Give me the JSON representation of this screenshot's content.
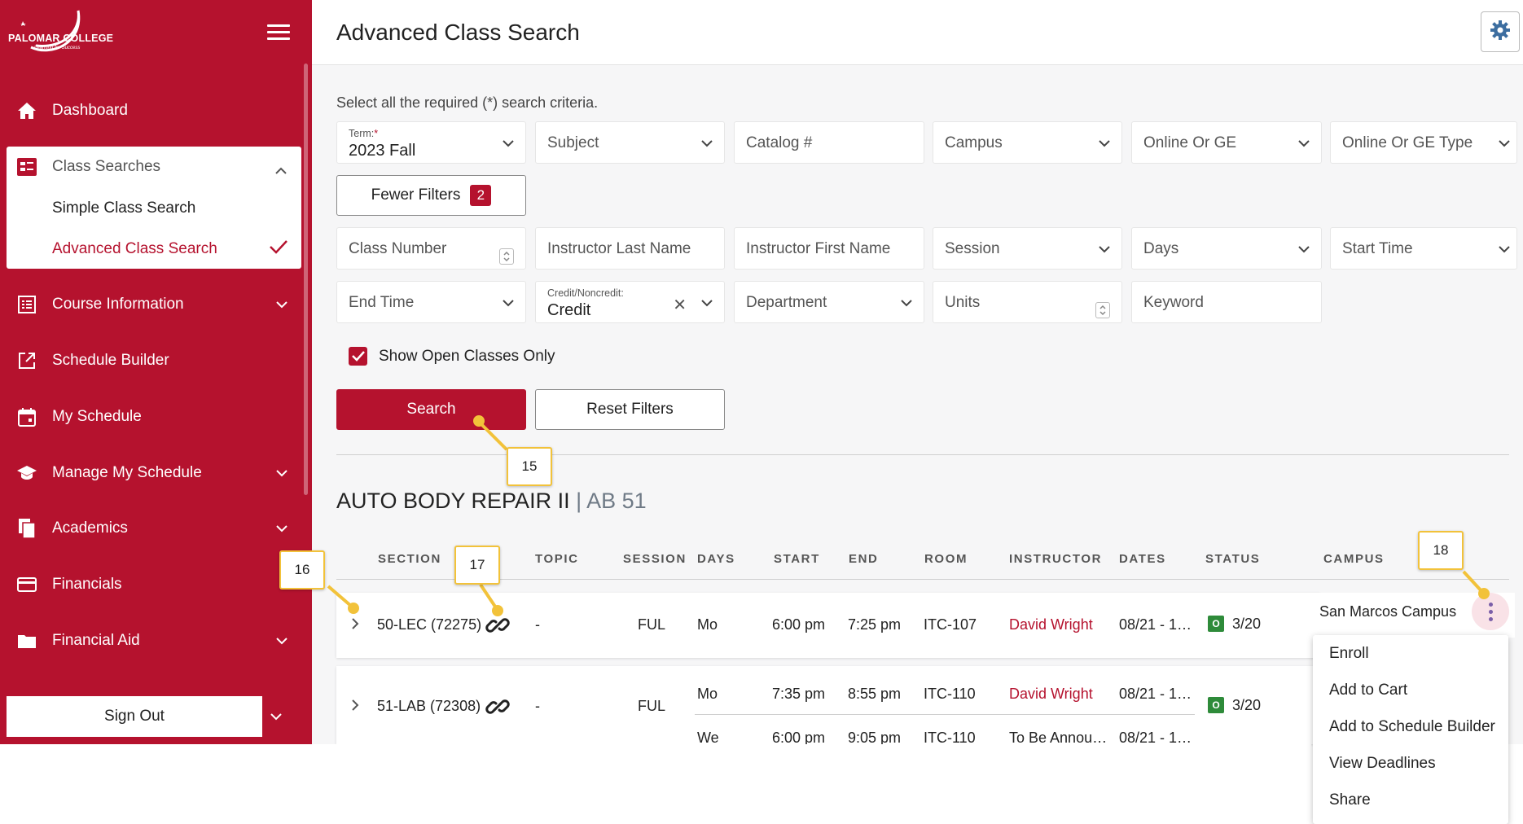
{
  "brand": {
    "name": "PALOMAR COLLEGE",
    "tagline": "Learning for Success"
  },
  "sidebar": {
    "items": [
      {
        "label": "Dashboard",
        "icon": "home-icon"
      },
      {
        "label": "Class Searches",
        "icon": "search-list-icon",
        "open": true,
        "children": [
          {
            "label": "Simple Class Search"
          },
          {
            "label": "Advanced Class Search",
            "active": true
          }
        ]
      },
      {
        "label": "Course Information",
        "icon": "list-icon"
      },
      {
        "label": "Schedule Builder",
        "icon": "external-edit-icon"
      },
      {
        "label": "My Schedule",
        "icon": "calendar-icon"
      },
      {
        "label": "Manage My Schedule",
        "icon": "graduation-cap-icon"
      },
      {
        "label": "Academics",
        "icon": "documents-icon"
      },
      {
        "label": "Financials",
        "icon": "credit-card-icon"
      },
      {
        "label": "Financial Aid",
        "icon": "folder-icon"
      }
    ],
    "sign_out": "Sign Out"
  },
  "header": {
    "title": "Advanced Class Search"
  },
  "search": {
    "instructions": "Select all the required (*) search criteria.",
    "term": {
      "label": "Term:",
      "required_mark": "*",
      "value": "2023 Fall"
    },
    "subject": "Subject",
    "catalog": "Catalog #",
    "campus": "Campus",
    "online_or_ge": "Online Or GE",
    "online_or_ge_type": "Online Or GE Type",
    "fewer_filters": "Fewer Filters",
    "filter_count": "2",
    "class_number": "Class Number",
    "instructor_last": "Instructor Last Name",
    "instructor_first": "Instructor First Name",
    "session": "Session",
    "days": "Days",
    "start_time": "Start Time",
    "end_time": "End Time",
    "credit": {
      "label": "Credit/Noncredit:",
      "value": "Credit",
      "clear": "✕"
    },
    "department": "Department",
    "units": "Units",
    "keyword": "Keyword",
    "open_only": "Show Open Classes Only",
    "search_btn": "Search",
    "reset_btn": "Reset Filters"
  },
  "course": {
    "title": "AUTO BODY REPAIR II",
    "separator": "|",
    "code": "AB 51"
  },
  "table": {
    "headers": [
      "SECTION",
      "TOPIC",
      "SESSION",
      "DAYS",
      "START",
      "END",
      "ROOM",
      "INSTRUCTOR",
      "DATES",
      "STATUS",
      "CAMPUS"
    ],
    "rows": [
      {
        "section": "50-LEC (72275)",
        "topic": "-",
        "session": "FUL",
        "meetings": [
          {
            "days": "Mo",
            "start": "6:00 pm",
            "end": "7:25 pm",
            "room": "ITC-107",
            "instructor": "David Wright",
            "dates": "08/21 - 1…"
          }
        ],
        "status_icon": "O",
        "status": "3/20",
        "campus": "San Marcos Campus"
      },
      {
        "section": "51-LAB (72308)",
        "topic": "-",
        "session": "FUL",
        "meetings": [
          {
            "days": "Mo",
            "start": "7:35 pm",
            "end": "8:55 pm",
            "room": "ITC-110",
            "instructor": "David Wright",
            "dates": "08/21 - 1…"
          },
          {
            "days": "We",
            "start": "6:00 pm",
            "end": "9:05 pm",
            "room": "ITC-110",
            "instructor": "To Be Annou…",
            "dates": "08/21 - 1…"
          }
        ],
        "status_icon": "O",
        "status": "3/20"
      }
    ]
  },
  "row_menu": [
    "Enroll",
    "Add to Cart",
    "Add to Schedule Builder",
    "View Deadlines",
    "Share"
  ],
  "callouts": [
    "15",
    "16",
    "17",
    "18"
  ],
  "colors": {
    "brand": "#b5122e",
    "status_open": "#2e8b3a",
    "callout_border": "#f2c23a"
  }
}
